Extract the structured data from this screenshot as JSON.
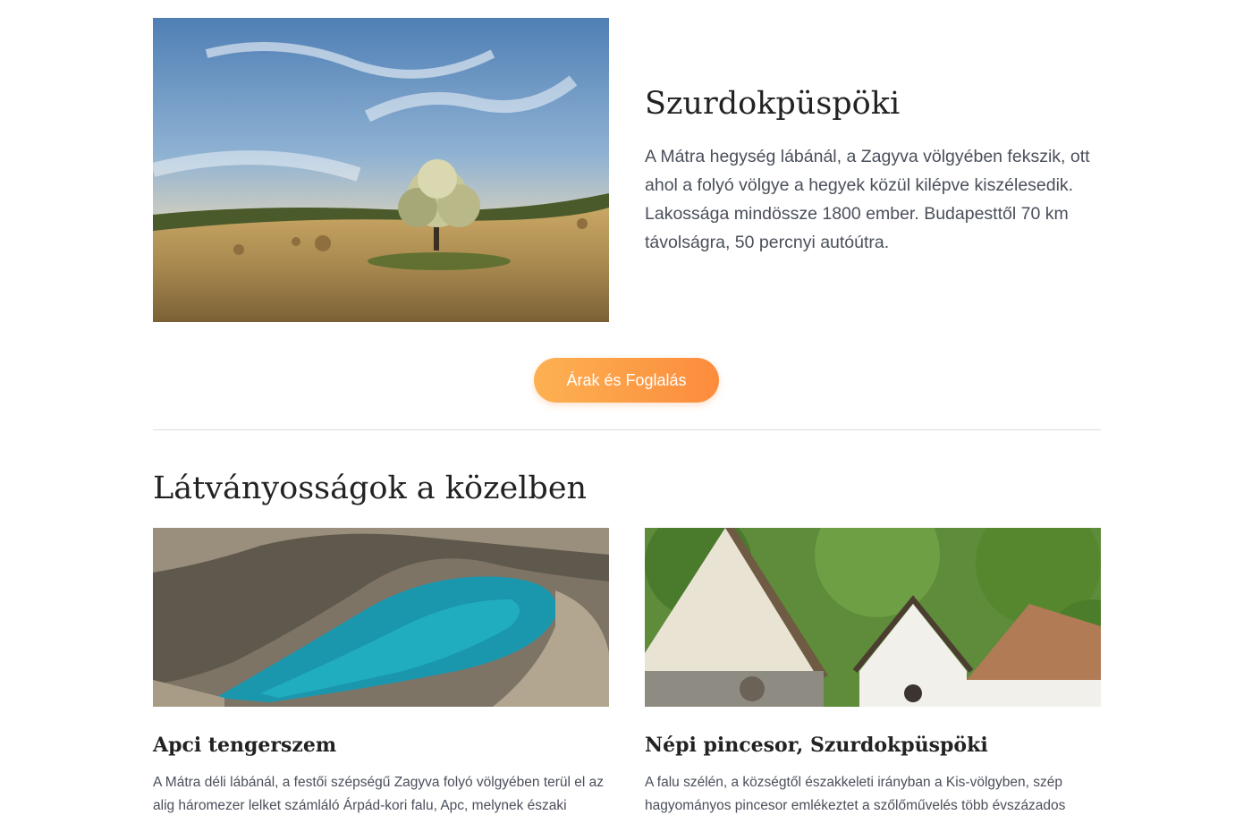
{
  "village": {
    "image_alt": "Szurdokpüspöki landscape with a tree and hay bales",
    "title": "Szurdokpüspöki",
    "description": "A Mátra hegység lábánál, a Zagyva völgyében fekszik, ott ahol a folyó völgye a hegyek közül kilépve kiszélesedik. Lakossága mindössze 1800 ember. Budapesttől 70 km távolságra, 50 percnyi autóútra."
  },
  "cta": {
    "label": "Árak és Foglalás",
    "color_start": "#fdb153",
    "color_end": "#fc8c3c"
  },
  "attractions": {
    "title": "Látványosságok a közelben",
    "items": [
      {
        "title": "Apci tengerszem",
        "description": "A Mátra déli lábánál, a festői szépségű Zagyva folyó völgyében terül el az alig háromezer lelket számláló Árpád-kori falu, Apc, melynek északi",
        "image_alt": "Turquoise quarry lake surrounded by rocky cliffs"
      },
      {
        "title": "Népi pincesor, Szurdokpüspöki",
        "description": "A falu szélén, a községtől északkeleti irányban a Kis-völgyben, szép hagyományos pincesor emlékeztet a szőlőművelés több évszázados",
        "image_alt": "White wine cellar houses with steep roofs among green trees"
      }
    ]
  }
}
